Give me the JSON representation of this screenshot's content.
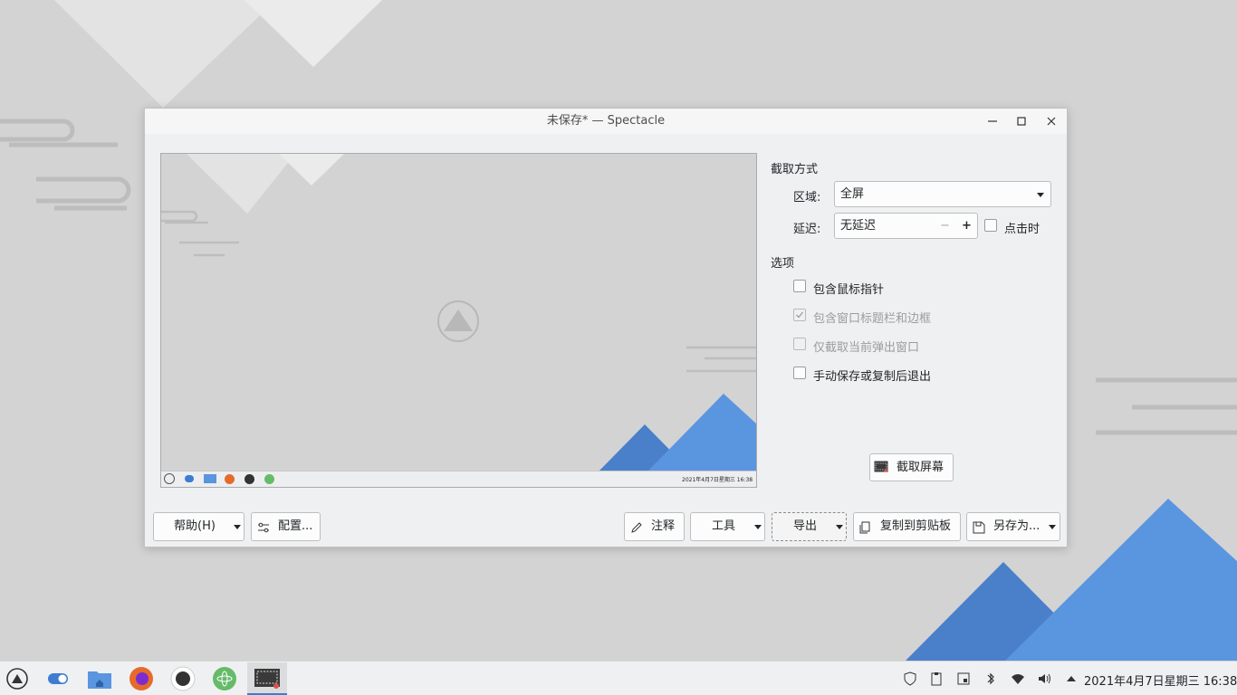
{
  "window": {
    "title": "未保存* — Spectacle"
  },
  "capture": {
    "section_title": "截取方式",
    "area_label": "区域:",
    "area_value": "全屏",
    "delay_label": "延迟:",
    "delay_value": "无延迟",
    "delay_minus": "−",
    "delay_plus": "+",
    "on_click_label": "点击时",
    "take_button": "截取屏幕"
  },
  "options": {
    "section_title": "选项",
    "items": [
      {
        "label": "包含鼠标指针",
        "checked": false,
        "enabled": true
      },
      {
        "label": "包含窗口标题栏和边框",
        "checked": true,
        "enabled": false
      },
      {
        "label": "仅截取当前弹出窗口",
        "checked": false,
        "enabled": false
      },
      {
        "label": "手动保存或复制后退出",
        "checked": false,
        "enabled": true
      }
    ]
  },
  "footer": {
    "help": "帮助(H)",
    "configure": "配置...",
    "annotate": "注释",
    "tools": "工具",
    "export": "导出",
    "copy_clipboard": "复制到剪贴板",
    "save_as": "另存为..."
  },
  "preview": {
    "mini_clock": "2021年4月7日星期三 16:38"
  },
  "taskbar": {
    "clock": "2021年4月7日星期三 16:38",
    "apps": [
      "app-launcher-icon",
      "settings-toggle-icon",
      "file-manager-icon",
      "firefox-icon",
      "github-desktop-icon",
      "atom-icon",
      "spectacle-icon"
    ]
  },
  "colors": {
    "accent": "#3d7cd2",
    "mountain_dark": "#4a7fc9",
    "mountain_light": "#5a95e0"
  }
}
